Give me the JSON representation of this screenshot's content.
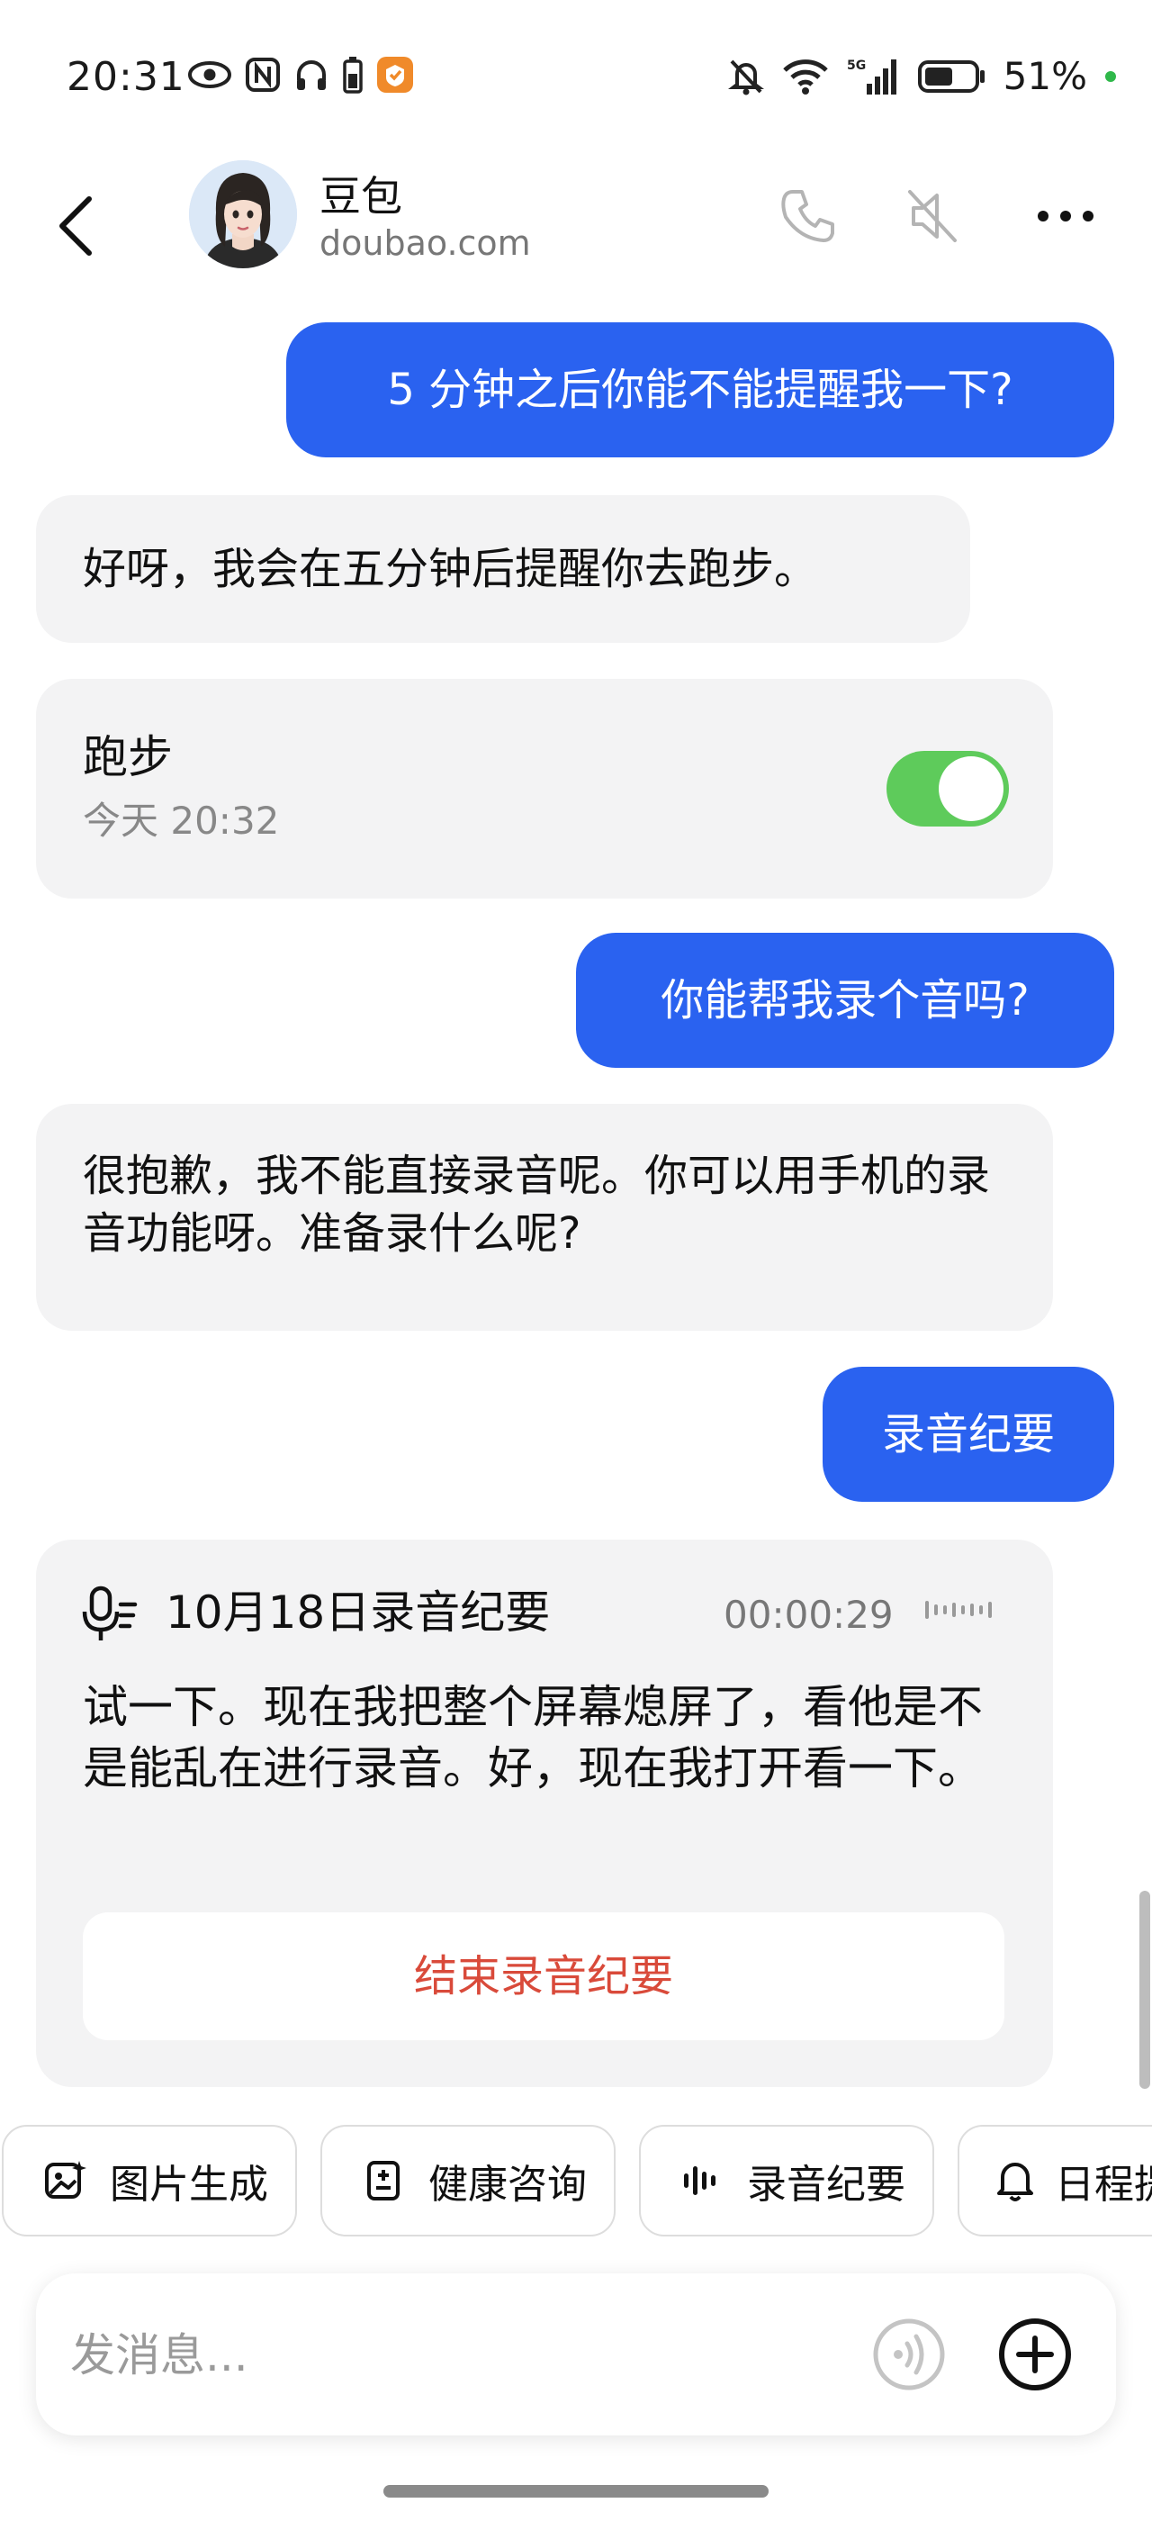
{
  "status_bar": {
    "time": "20:31",
    "battery": "51%",
    "network": "5G",
    "icons": [
      "eye-icon",
      "nfc-icon",
      "headphones-icon",
      "battery-small-icon",
      "app-badge-icon",
      "mute-bell-icon",
      "wifi-icon",
      "signal-icon",
      "battery-icon"
    ]
  },
  "header": {
    "contact_name": "豆包",
    "contact_domain": "doubao.com",
    "icons": [
      "back-icon",
      "phone-icon",
      "speaker-mute-icon",
      "more-icon"
    ]
  },
  "messages": {
    "m1": "5 分钟之后你能不能提醒我一下?",
    "m2": "好呀，我会在五分钟后提醒你去跑步。",
    "reminder": {
      "title": "跑步",
      "time": "今天 20:32",
      "enabled": true
    },
    "m3": "你能帮我录个音吗?",
    "m4": "很抱歉，我不能直接录音呢。你可以用手机的录音功能呀。准备录什么呢?",
    "m5": "录音纪要",
    "recording": {
      "title": "10月18日录音纪要",
      "duration": "00:00:29",
      "transcript": "试一下。现在我把整个屏幕熄屏了，看他是不是能乱在进行录音。好，现在我打开看一下。",
      "end_button": "结束录音纪要",
      "end_button_color": "#d94a3a"
    }
  },
  "quick_actions": [
    {
      "label": "图片生成",
      "icon": "image-gen-icon"
    },
    {
      "label": "健康咨询",
      "icon": "health-icon"
    },
    {
      "label": "录音纪要",
      "icon": "waveform-icon"
    },
    {
      "label": "日程提",
      "icon": "bell-icon"
    }
  ],
  "input": {
    "placeholder": "发消息...",
    "value": ""
  },
  "colors": {
    "user_bubble": "#2a62f0",
    "bot_bubble": "#f3f3f4",
    "toggle_on": "#5ecb5b"
  }
}
